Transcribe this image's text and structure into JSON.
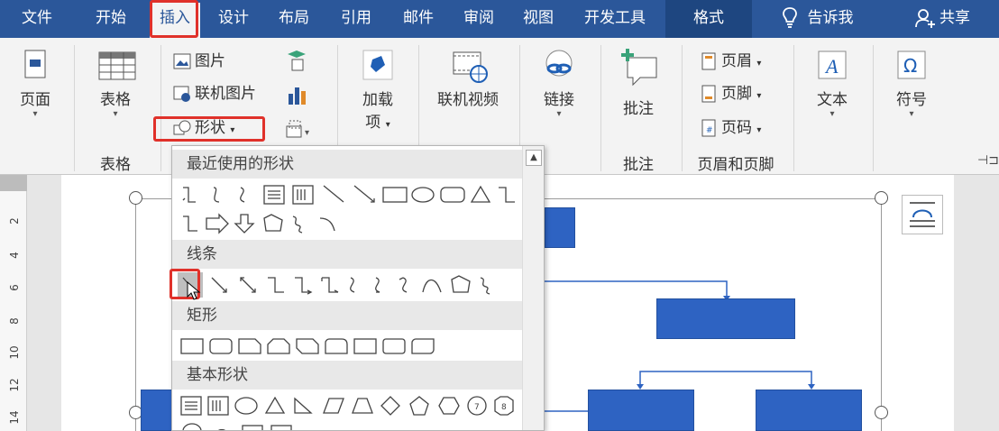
{
  "menu": {
    "tabs": [
      "文件",
      "开始",
      "插入",
      "设计",
      "布局",
      "引用",
      "邮件",
      "审阅",
      "视图",
      "开发工具",
      "格式"
    ],
    "tell_me": "告诉我",
    "share": "共享"
  },
  "ribbon": {
    "page": "页面",
    "table": "表格",
    "table_group": "表格",
    "picture": "图片",
    "online_picture": "联机图片",
    "shapes": "形状",
    "addins_line1": "加载",
    "addins_line2": "项",
    "online_video": "联机视频",
    "link": "链接",
    "comment": "批注",
    "comment_group": "批注",
    "header": "页眉",
    "footer": "页脚",
    "page_number": "页码",
    "header_footer_group": "页眉和页脚",
    "text": "文本",
    "symbol": "符号"
  },
  "shapes_menu": {
    "recent": "最近使用的形状",
    "lines": "线条",
    "rectangles": "矩形",
    "basic": "基本形状"
  },
  "ruler": {
    "marks": [
      "2",
      "4",
      "6",
      "8",
      "10",
      "12",
      "14"
    ]
  },
  "colors": {
    "title_bar": "#2b579a",
    "highlight": "#e0312a",
    "flow_box": "#2e63c2"
  }
}
